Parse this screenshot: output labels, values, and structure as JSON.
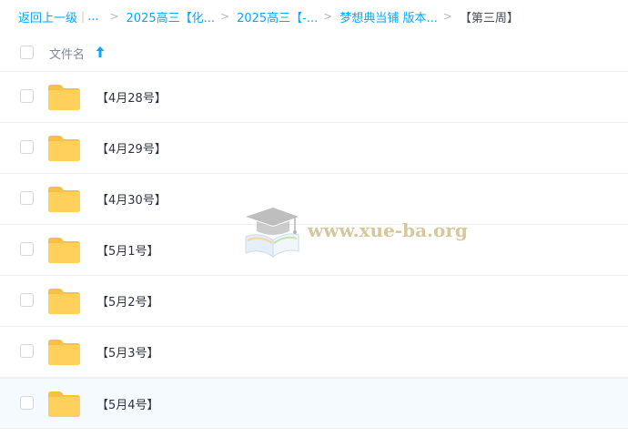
{
  "breadcrumb": {
    "back_label": "返回上一级",
    "separator": "|",
    "ellipsis": "...",
    "arrow": ">",
    "items": [
      "2025高三【化...",
      "2025高三【-...",
      "梦想典当铺 版本..."
    ],
    "current": "【第三周】"
  },
  "list_header": {
    "column_name": "文件名",
    "sort_direction": "ascending",
    "sort_icon": "arrow-up-icon"
  },
  "files": [
    {
      "name": "【4月28号】",
      "type": "folder"
    },
    {
      "name": "【4月29号】",
      "type": "folder"
    },
    {
      "name": "【4月30号】",
      "type": "folder"
    },
    {
      "name": "【5月1号】",
      "type": "folder"
    },
    {
      "name": "【5月2号】",
      "type": "folder"
    },
    {
      "name": "【5月3号】",
      "type": "folder"
    },
    {
      "name": "【5月4号】",
      "type": "folder",
      "hovered": true
    }
  ],
  "watermark": {
    "text": "www.xue-ba.org",
    "icon": "graduation-cap-book-icon"
  },
  "colors": {
    "link": "#06a7ff",
    "folder": "#ffd15c",
    "folder_back": "#f7c244",
    "text": "#2d3340",
    "header_text": "#818999",
    "row_hover": "#f5faff",
    "watermark": "#b89a4e"
  }
}
